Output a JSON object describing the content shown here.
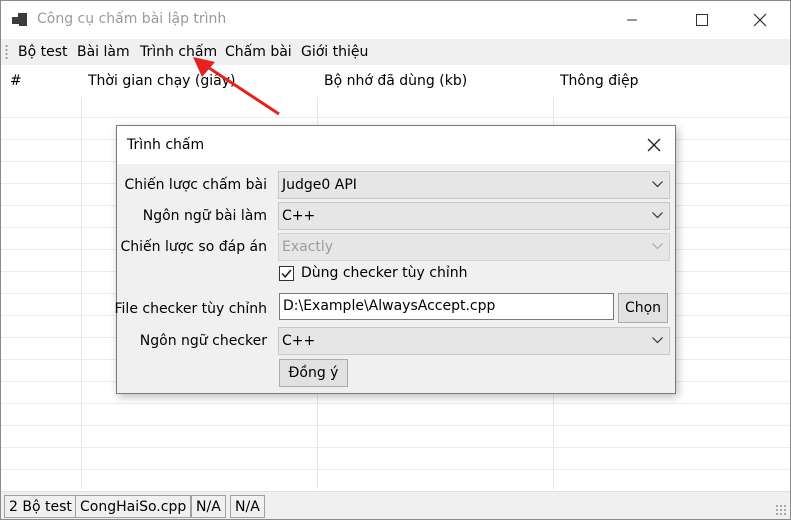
{
  "window": {
    "title": "Công cụ chấm bài lập trình"
  },
  "menu": {
    "items": [
      "Bộ test",
      "Bài làm",
      "Trình chấm",
      "Chấm bài",
      "Giới thiệu"
    ]
  },
  "grid": {
    "columns": [
      "#",
      "Thời gian chạy (giây)",
      "Bộ nhớ đã dùng (kb)",
      "Thông điệp"
    ]
  },
  "dialog": {
    "title": "Trình chấm",
    "judge_strategy_label": "Chiến lược chấm bài",
    "judge_strategy_value": "Judge0 API",
    "language_label": "Ngôn ngữ bài làm",
    "language_value": "C++",
    "compare_label": "Chiến lược so đáp án",
    "compare_value": "Exactly",
    "use_checker_label": "Dùng checker tùy chỉnh",
    "use_checker_checked": true,
    "checker_file_label": "File checker tùy chỉnh",
    "checker_file_value": "D:\\Example\\AlwaysAccept.cpp",
    "browse_button": "Chọn",
    "checker_language_label": "Ngôn ngữ checker",
    "checker_language_value": "C++",
    "ok_button": "Đồng ý"
  },
  "status": {
    "test_count": "2 Bộ test",
    "file": "CongHaiSo.cpp",
    "field3": "N/A",
    "field4": "N/A"
  },
  "annotation": {
    "arrow_color": "#e8211e"
  }
}
